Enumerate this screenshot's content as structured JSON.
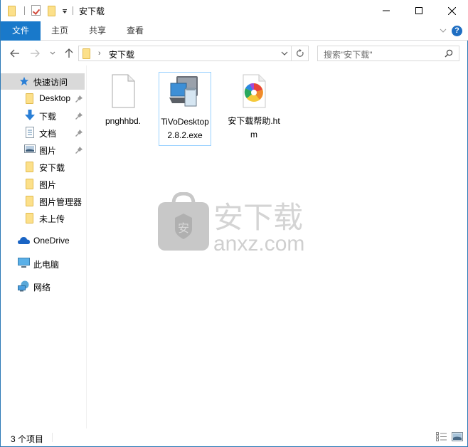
{
  "window": {
    "title": "安下载",
    "controls": {
      "minimize": "minimize",
      "maximize": "maximize",
      "close": "close"
    }
  },
  "ribbon": {
    "tabs": [
      {
        "label": "文件",
        "active": true
      },
      {
        "label": "主页"
      },
      {
        "label": "共享"
      },
      {
        "label": "查看"
      }
    ],
    "help": "?"
  },
  "navigation": {
    "address_segment": "安下载",
    "search_placeholder": "搜索\"安下载\""
  },
  "sidebar": {
    "quick_access": "快速访问",
    "items": [
      {
        "label": "Desktop",
        "icon": "folder-icon",
        "pinned": true
      },
      {
        "label": "下载",
        "icon": "download-arrow-icon",
        "pinned": true
      },
      {
        "label": "文档",
        "icon": "document-icon",
        "pinned": true
      },
      {
        "label": "图片",
        "icon": "pictures-icon",
        "pinned": true
      },
      {
        "label": "安下载",
        "icon": "folder-icon",
        "pinned": false
      },
      {
        "label": "图片",
        "icon": "folder-icon",
        "pinned": false
      },
      {
        "label": "图片管理器",
        "icon": "folder-icon",
        "pinned": false
      },
      {
        "label": "未上传",
        "icon": "folder-icon",
        "pinned": false
      }
    ],
    "onedrive": "OneDrive",
    "this_pc": "此电脑",
    "network": "网络"
  },
  "files": [
    {
      "name": "pnghhbd.",
      "icon": "blank-file-icon",
      "selected": false
    },
    {
      "name": "TiVoDesktop2.8.2.exe",
      "icon": "installer-exe-icon",
      "selected": true
    },
    {
      "name": "安下载帮助.htm",
      "icon": "html-file-icon",
      "selected": false
    }
  ],
  "watermark": {
    "cn": "安下载",
    "url": "anxz.com",
    "badge": "安"
  },
  "status": {
    "item_count": "3 个项目"
  },
  "colors": {
    "accent": "#1979ca",
    "selection_border": "#99d1ff",
    "folder": "#fce08a"
  }
}
